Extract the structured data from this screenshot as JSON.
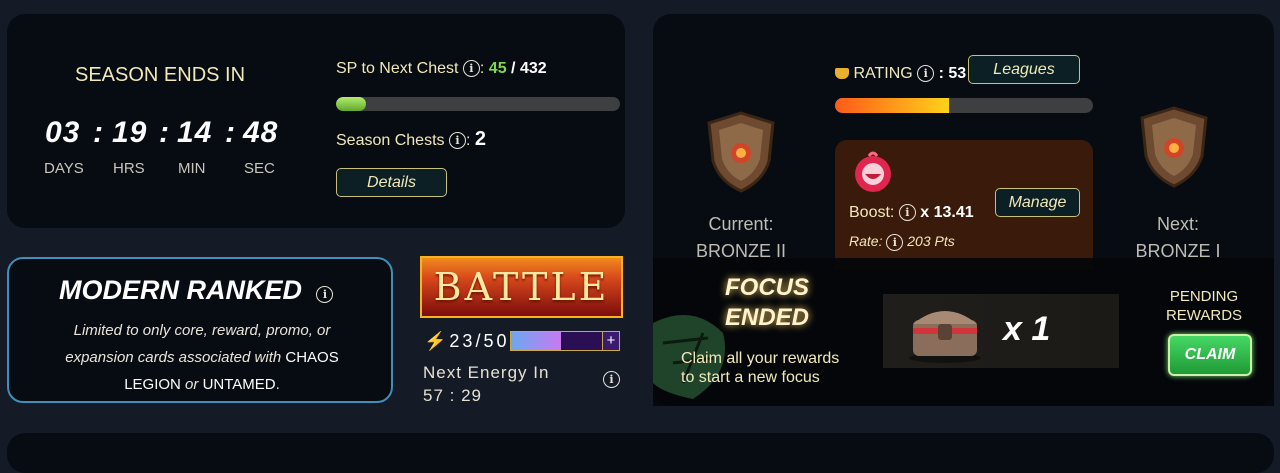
{
  "season": {
    "title": "SEASON ENDS IN",
    "timer": {
      "days": "03",
      "hrs": "19",
      "min": "14",
      "sec": "48"
    },
    "sep": ":",
    "labels": {
      "days": "DAYS",
      "hrs": "HRS",
      "min": "MIN",
      "sec": "SEC"
    },
    "sp_label": "SP to Next Chest",
    "sp_current": "45",
    "sp_total": "/ 432",
    "sp_progress": 0.104,
    "chests_label": "Season Chests",
    "chests_value": "2",
    "details_label": "Details"
  },
  "league": {
    "rating_label": "RATING",
    "rating_value": ": 53",
    "leagues_button": "Leagues",
    "rating_progress": 0.44,
    "current_label": "Current:",
    "current_league": "BRONZE II",
    "next_label": "Next:",
    "next_league": "BRONZE I",
    "boost_label": "Boost:",
    "boost_value": "x 13.41",
    "manage_label": "Manage",
    "rate_label": "Rate:",
    "rate_value": "203 Pts"
  },
  "mode": {
    "title": "MODERN RANKED",
    "desc_1": "Limited to only core, reward, promo, or expansion cards associated with",
    "edition_1": "CHAOS LEGION",
    "desc_or": "or",
    "edition_2": "UNTAMED",
    "desc_end": "."
  },
  "battle": {
    "label": "BATTLE",
    "energy": "23/50",
    "energy_fraction": 0.46,
    "plus": "+",
    "next_energy_label": "Next Energy In",
    "next_energy_time": "57 : 29"
  },
  "focus": {
    "title_1": "FOCUS",
    "title_2": "ENDED",
    "claim_text_1": "Claim all your rewards",
    "claim_text_2": "to start a new focus",
    "chest_count": "x 1",
    "pending_1": "PENDING",
    "pending_2": "REWARDS",
    "claim_button": "CLAIM"
  },
  "colors": {
    "sp_value": "#7ed957",
    "accent_gold": "#f1e9b9",
    "mode_border": "#3f8fb8",
    "claim_green": "#2fbf4a",
    "boost_panel": "#3a1a0a"
  }
}
